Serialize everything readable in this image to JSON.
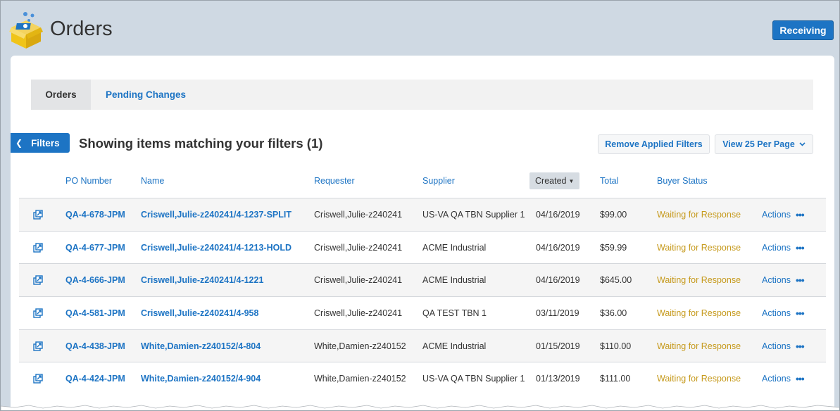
{
  "header": {
    "title": "Orders",
    "receiving_label": "Receiving"
  },
  "tabs": [
    {
      "label": "Orders",
      "active": true
    },
    {
      "label": "Pending Changes",
      "active": false
    }
  ],
  "toolbar": {
    "filters_label": "Filters",
    "results_heading": "Showing items matching your filters (1)",
    "remove_filters_label": "Remove Applied Filters",
    "per_page_label": "View 25 Per Page"
  },
  "table": {
    "columns": {
      "po": "PO Number",
      "name": "Name",
      "requester": "Requester",
      "supplier": "Supplier",
      "created": "Created",
      "total": "Total",
      "buyer_status": "Buyer Status"
    },
    "rows": [
      {
        "po": "QA-4-678-JPM",
        "name": "Criswell,Julie-z240241/4-1237-SPLIT",
        "requester": "Criswell,Julie-z240241",
        "supplier": "US-VA QA TBN Supplier 1",
        "created": "04/16/2019",
        "total": "$99.00",
        "status": "Waiting for Response",
        "actions": "Actions"
      },
      {
        "po": "QA-4-677-JPM",
        "name": "Criswell,Julie-z240241/4-1213-HOLD",
        "requester": "Criswell,Julie-z240241",
        "supplier": "ACME Industrial",
        "created": "04/16/2019",
        "total": "$59.99",
        "status": "Waiting for Response",
        "actions": "Actions"
      },
      {
        "po": "QA-4-666-JPM",
        "name": "Criswell,Julie-z240241/4-1221",
        "requester": "Criswell,Julie-z240241",
        "supplier": "ACME Industrial",
        "created": "04/16/2019",
        "total": "$645.00",
        "status": "Waiting for Response",
        "actions": "Actions"
      },
      {
        "po": "QA-4-581-JPM",
        "name": "Criswell,Julie-z240241/4-958",
        "requester": "Criswell,Julie-z240241",
        "supplier": "QA TEST TBN 1",
        "created": "03/11/2019",
        "total": "$36.00",
        "status": "Waiting for Response",
        "actions": "Actions"
      },
      {
        "po": "QA-4-438-JPM",
        "name": "White,Damien-z240152/4-804",
        "requester": "White,Damien-z240152",
        "supplier": "ACME Industrial",
        "created": "01/15/2019",
        "total": "$110.00",
        "status": "Waiting for Response",
        "actions": "Actions"
      },
      {
        "po": "QA-4-424-JPM",
        "name": "White,Damien-z240152/4-904",
        "requester": "White,Damien-z240152",
        "supplier": "US-VA QA TBN Supplier 1",
        "created": "01/13/2019",
        "total": "$111.00",
        "status": "Waiting for Response",
        "actions": "Actions"
      }
    ]
  },
  "colors": {
    "primary": "#1d74c4",
    "status_waiting": "#c69a1d",
    "header_bg": "#cfd9e3"
  },
  "icons": {
    "logo": "orders-box-logo",
    "row_icon": "open-external-icon",
    "filters_chevron": "chevron-left-icon",
    "per_page_chevron": "chevron-down-icon",
    "sort_caret": "caret-down-icon",
    "actions_more": "more-dots-icon"
  }
}
